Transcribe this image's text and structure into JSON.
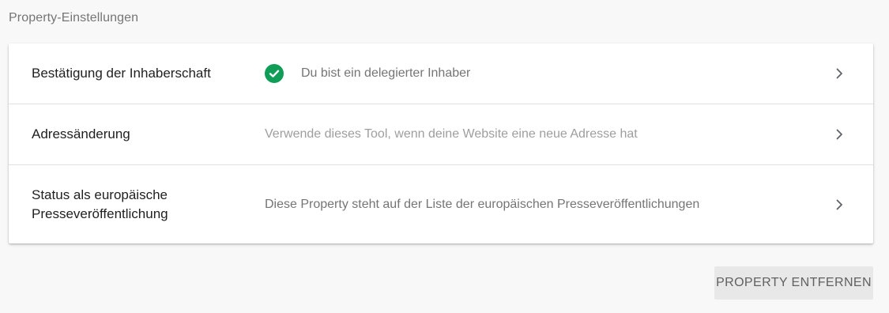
{
  "section": {
    "title": "Property-Einstellungen"
  },
  "rows": [
    {
      "label": "Bestätigung der Inhaberschaft",
      "status": "Du bist ein delegierter Inhaber",
      "status_icon": "check-circle-icon",
      "status_icon_color": "#0f9d58"
    },
    {
      "label": "Adressänderung",
      "status": "Verwende dieses Tool, wenn deine Website eine neue Adresse hat"
    },
    {
      "label": "Status als europäische Presseveröffentlichung",
      "status": "Diese Property steht auf der Liste der europäischen Presseveröffentlichungen"
    }
  ],
  "actions": {
    "remove_label": "PROPERTY ENTFERNEN"
  }
}
